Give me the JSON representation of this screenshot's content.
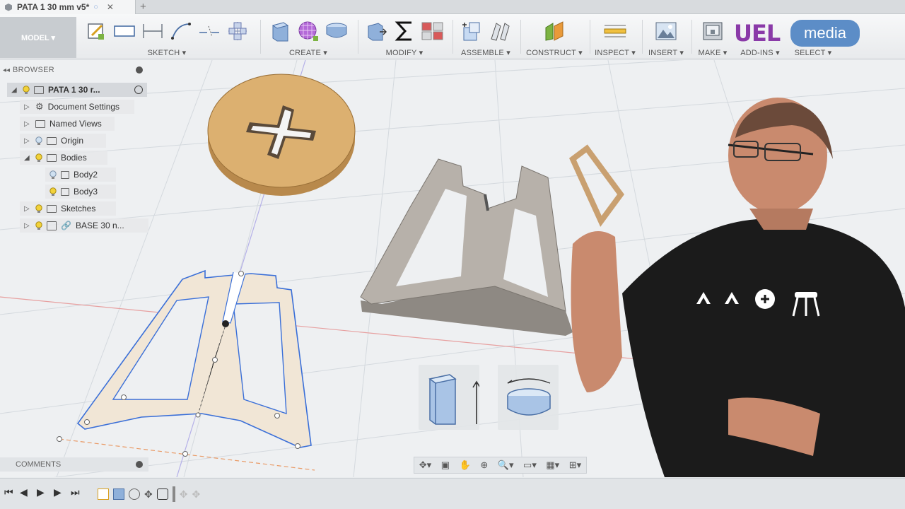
{
  "tab": {
    "title": "PATA 1 30 mm v5*",
    "close": "✕",
    "add": "+"
  },
  "mode": {
    "label": "MODEL ▾"
  },
  "toolbar": {
    "sketch": "SKETCH ▾",
    "create": "CREATE ▾",
    "modify": "MODIFY ▾",
    "assemble": "ASSEMBLE ▾",
    "construct": "CONSTRUCT ▾",
    "inspect": "INSPECT ▾",
    "insert": "INSERT ▾",
    "make": "MAKE ▾",
    "addins": "ADD-INS ▾",
    "select": "SELECT ▾"
  },
  "badges": {
    "uel": "UEL",
    "media": "media"
  },
  "browser": {
    "title": "BROWSER",
    "items": [
      {
        "label": "PATA 1 30 r..."
      },
      {
        "label": "Document Settings"
      },
      {
        "label": "Named Views"
      },
      {
        "label": "Origin"
      },
      {
        "label": "Bodies"
      },
      {
        "label": "Body2"
      },
      {
        "label": "Body3"
      },
      {
        "label": "Sketches"
      },
      {
        "label": "BASE 30 n..."
      }
    ]
  },
  "comments": {
    "title": "COMMENTS"
  },
  "colors": {
    "accent": "#5c8dc7",
    "wood": "#d4a460",
    "sketch_line": "#3a6fd8",
    "body_gray": "#a9a39d",
    "shirt": "#1b1b1b"
  }
}
